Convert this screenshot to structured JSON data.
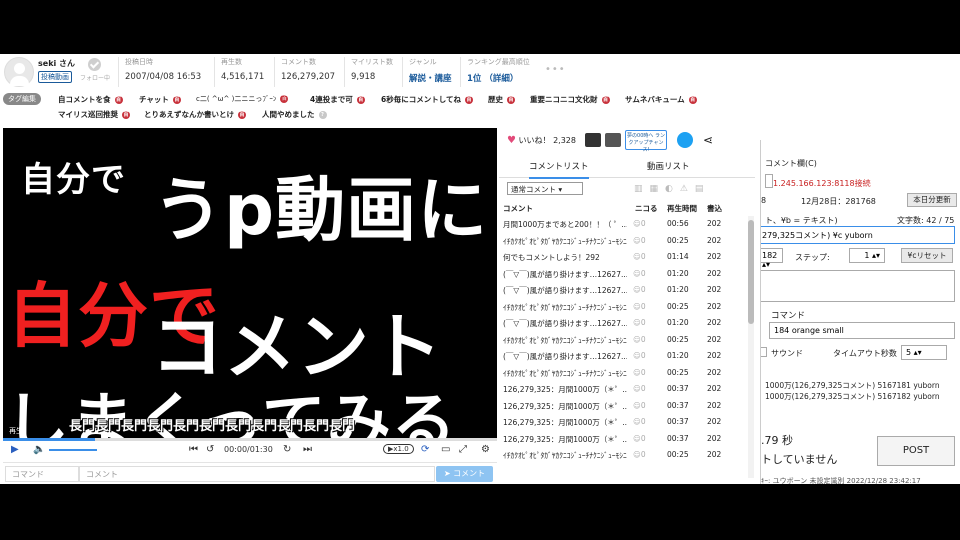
{
  "header": {
    "user_name": "seki さん",
    "user_tag": "投稿動画",
    "follow_label": "フォロー中",
    "stats": [
      {
        "label": "投稿日時",
        "value": "2007/04/08 16:53"
      },
      {
        "label": "再生数",
        "value": "4,516,171"
      },
      {
        "label": "コメント数",
        "value": "126,279,207"
      },
      {
        "label": "マイリスト数",
        "value": "9,918"
      },
      {
        "label": "ジャンル",
        "value": "解説・講座"
      },
      {
        "label": "ランキング最高順位",
        "value": "1位 （詳細）"
      }
    ]
  },
  "tags": {
    "edit_label": "タグ編集",
    "items": [
      "自コメントを食",
      "チャット",
      "c二( ^ω^ )二ニニっﾌﾞｰﾝ",
      "4連投まで可",
      "6秒毎にコメントしてね",
      "歴史",
      "重要ニコニコ文化財",
      "サムネバキューム",
      "マイリス巡回推奨",
      "とりあえずなんか書いとけ",
      "人間やめました"
    ]
  },
  "video": {
    "lines": [
      "自分で",
      "うp動画に",
      "自分で",
      "コメント",
      "しまくってみる"
    ],
    "subtitle": "長門長門長門長門長門長門長門長門長門長門長門",
    "play_label": "再生",
    "time": "00:00/01:30",
    "speed": "x1.0"
  },
  "comment_input": {
    "command_placeholder": "コマンド",
    "comment_placeholder": "コメント",
    "submit_label": "コメント"
  },
  "panel": {
    "like_label": "いいね！",
    "like_count": "2,328",
    "banner_text": "夢の00時へ ランクアップチャンス!",
    "tabs": [
      "コメントリスト",
      "動画リスト"
    ],
    "filter": "通常コメント",
    "columns": [
      "コメント",
      "ニコる",
      "再生時間",
      "書込"
    ],
    "rows": [
      {
        "c": "月間1000万まであと200！！（ ゜...",
        "n": "0",
        "t": "00:56",
        "d": "202"
      },
      {
        "c": "ｲﾁｶｸｵﾋﾟｵﾋﾟﾀｶﾞﾔｶｸﾆｺｼﾞｭｰﾁﾅｸﾆｼﾞｭｰﾓｼﾆﾐﾊｸﾅ",
        "n": "0",
        "t": "00:25",
        "d": "202"
      },
      {
        "c": "何でもコメントしよう！292",
        "n": "0",
        "t": "01:14",
        "d": "202"
      },
      {
        "c": "(￣▽￣)風が語り掛けます…12627...",
        "n": "0",
        "t": "01:20",
        "d": "202"
      },
      {
        "c": "(￣▽￣)風が語り掛けます…12627...",
        "n": "0",
        "t": "01:20",
        "d": "202"
      },
      {
        "c": "ｲﾁｶｸｵﾋﾟｵﾋﾟﾀｶﾞﾔｶｸﾆｺｼﾞｭｰﾁﾅｸﾆｼﾞｭｰﾓｼﾆﾐﾊｸﾅ",
        "n": "0",
        "t": "00:25",
        "d": "202"
      },
      {
        "c": "(￣▽￣)風が語り掛けます…12627...",
        "n": "0",
        "t": "01:20",
        "d": "202"
      },
      {
        "c": "ｲﾁｶｸｵﾋﾟｵﾋﾟﾀｶﾞﾔｶｸﾆｺｼﾞｭｰﾁﾅｸﾆｼﾞｭｰﾓｼﾆﾐﾊｸﾅ",
        "n": "0",
        "t": "00:25",
        "d": "202"
      },
      {
        "c": "(￣▽￣)風が語り掛けます…12627...",
        "n": "0",
        "t": "01:20",
        "d": "202"
      },
      {
        "c": "ｲﾁｶｸｵﾋﾟｵﾋﾟﾀｶﾞﾔｶｸﾆｺｼﾞｭｰﾁﾅｸﾆｼﾞｭｰﾓｼﾆﾐﾊｸﾅ",
        "n": "0",
        "t": "00:25",
        "d": "202"
      },
      {
        "c": "126,279,325：月間1000万（＊゜...",
        "n": "0",
        "t": "00:37",
        "d": "202"
      },
      {
        "c": "126,279,325：月間1000万（＊゜...",
        "n": "0",
        "t": "00:37",
        "d": "202"
      },
      {
        "c": "126,279,325：月間1000万（＊゜...",
        "n": "0",
        "t": "00:37",
        "d": "202"
      },
      {
        "c": "126,279,325：月間1000万（＊゜...",
        "n": "0",
        "t": "00:37",
        "d": "202"
      },
      {
        "c": "ｲﾁｶｸｵﾋﾟｵﾋﾟﾀｶﾞﾔｶｸﾆｺｼﾞｭｰﾁﾅｸﾆｼﾞｭｰﾓｼﾆﾐﾊｸﾅ",
        "n": "0",
        "t": "00:25",
        "d": "202"
      }
    ]
  },
  "tool": {
    "comment_section": "コメント欄(C)",
    "ip": "1.245.166.123:8118接続",
    "v8": "8",
    "date": "12月28日：281768",
    "refresh": "本日分更新",
    "fmt": "ト、¥b = テキスト)",
    "chars": "文字数: 42 / 75",
    "text_value": "279,325コメント) ¥c yuborn",
    "v182": "182",
    "step_label": "ステップ:",
    "step_value": "1",
    "reset": "¥cリセット",
    "command_label": "コマンド",
    "command_value": "184 orange small",
    "sound_label": "サウンド",
    "timeout_label": "タイムアウト秒数",
    "timeout_value": "5",
    "log1": "1000万(126,279,325コメント) 5167181 yuborn",
    "log2": "1000万(126,279,325コメント) 5167182 yuborn",
    "seconds": ".79 秒",
    "status": "トしていません",
    "post": "POST",
    "bottom": "ｷｰ: ユウボーン  未設定識別  2022/12/28 23:42:17"
  }
}
